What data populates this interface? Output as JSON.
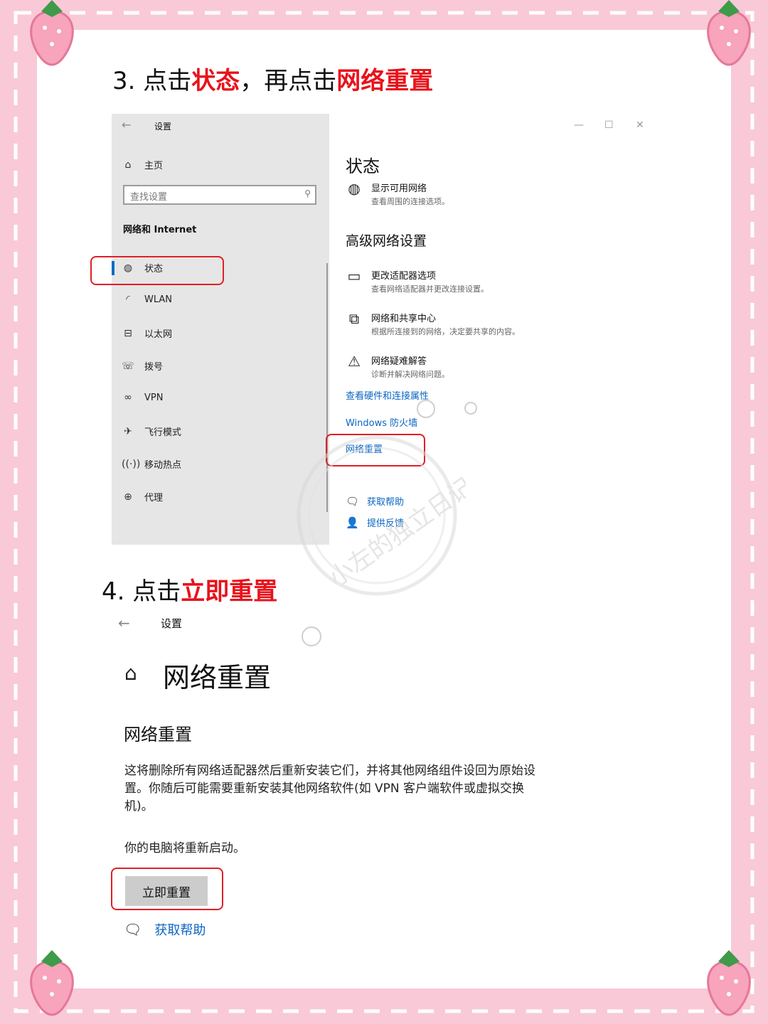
{
  "step3": {
    "prefix": "3. 点击",
    "highlight1": "状态",
    "middle": "，再点击",
    "highlight2": "网络重置"
  },
  "step4": {
    "prefix": "4. 点击",
    "highlight": "立即重置"
  },
  "shot1": {
    "back_icon": "←",
    "window_title": "设置",
    "home_label": "主页",
    "search_placeholder": "查找设置",
    "section_label": "网络和 Internet",
    "nav_items": [
      {
        "label": "状态",
        "icon": "globe-icon"
      },
      {
        "label": "WLAN",
        "icon": "wifi-icon"
      },
      {
        "label": "以太网",
        "icon": "ethernet-icon"
      },
      {
        "label": "拨号",
        "icon": "dialup-icon"
      },
      {
        "label": "VPN",
        "icon": "vpn-icon"
      },
      {
        "label": "飞行模式",
        "icon": "airplane-icon"
      },
      {
        "label": "移动热点",
        "icon": "hotspot-icon"
      },
      {
        "label": "代理",
        "icon": "proxy-globe-icon"
      }
    ],
    "main": {
      "title": "状态",
      "show_networks_title": "显示可用网络",
      "show_networks_desc": "查看周围的连接选项。",
      "advanced_heading": "高级网络设置",
      "items": [
        {
          "title": "更改适配器选项",
          "desc": "查看网络适配器并更改连接设置。",
          "icon": "monitor-icon"
        },
        {
          "title": "网络和共享中心",
          "desc": "根据所连接到的网络，决定要共享的内容。",
          "icon": "share-center-icon"
        },
        {
          "title": "网络疑难解答",
          "desc": "诊断并解决网络问题。",
          "icon": "warning-icon"
        }
      ],
      "link_hardware": "查看硬件和连接属性",
      "link_firewall": "Windows 防火墙",
      "link_reset": "网络重置",
      "get_help": "获取帮助",
      "feedback": "提供反馈"
    },
    "window_controls": [
      "—",
      "☐",
      "✕"
    ]
  },
  "shot2": {
    "back_icon": "←",
    "window_title": "设置",
    "page_title": "网络重置",
    "section_title": "网络重置",
    "description": "这将删除所有网络适配器然后重新安装它们，并将其他网络组件设回为原始设置。你随后可能需要重新安装其他网络软件(如 VPN 客户端软件或虚拟交换机)。",
    "restart_note": "你的电脑将重新启动。",
    "reset_button": "立即重置",
    "get_help": "获取帮助"
  },
  "watermark_text": "小左的独立日记",
  "colors": {
    "highlight_red": "#e8121b",
    "link_blue": "#0b66c3",
    "frame_pink": "#f9c9d7"
  }
}
